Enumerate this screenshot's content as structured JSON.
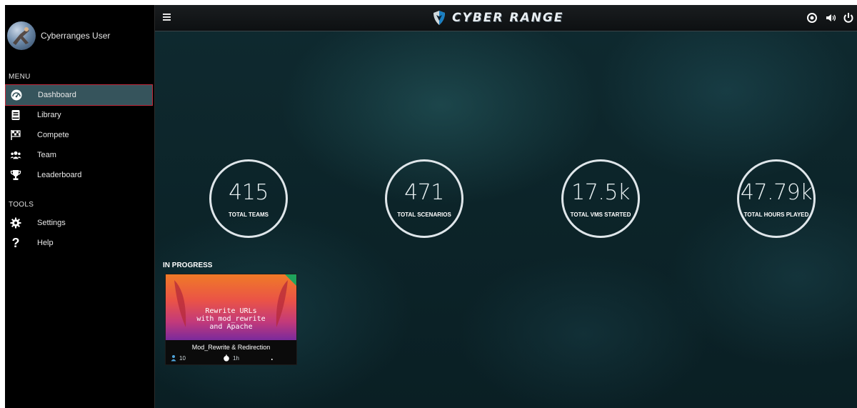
{
  "user": {
    "name": "Cyberranges User"
  },
  "menu": {
    "title": "MENU",
    "items": [
      {
        "label": "Dashboard",
        "icon": "gauge-icon",
        "active": true
      },
      {
        "label": "Library",
        "icon": "book-icon"
      },
      {
        "label": "Compete",
        "icon": "checkered-flag-icon"
      },
      {
        "label": "Team",
        "icon": "users-icon"
      },
      {
        "label": "Leaderboard",
        "icon": "trophy-icon"
      }
    ]
  },
  "tools": {
    "title": "TOOLS",
    "items": [
      {
        "label": "Settings",
        "icon": "gear-icon"
      },
      {
        "label": "Help",
        "icon": "question-icon"
      }
    ]
  },
  "header": {
    "logo_text": "CYBER RANGE"
  },
  "stats": [
    {
      "value": "415",
      "label": "TOTAL TEAMS"
    },
    {
      "value": "471",
      "label": "TOTAL SCENARIOS"
    },
    {
      "value": "17.5k",
      "label": "TOTAL VMS STARTED"
    },
    {
      "value": "47.79k",
      "label": "TOTAL HOURS PLAYED"
    }
  ],
  "in_progress": {
    "title": "IN PROGRESS",
    "cards": [
      {
        "thumb_title": "Rewrite URLs\nwith mod_rewrite\nand Apache",
        "name": "Mod_Rewrite & Redirection",
        "points": "10",
        "duration": "1h"
      }
    ]
  },
  "colors": {
    "accent_active": "#36545c",
    "active_border": "#c0283a",
    "card_corner": "#1fa35c"
  }
}
